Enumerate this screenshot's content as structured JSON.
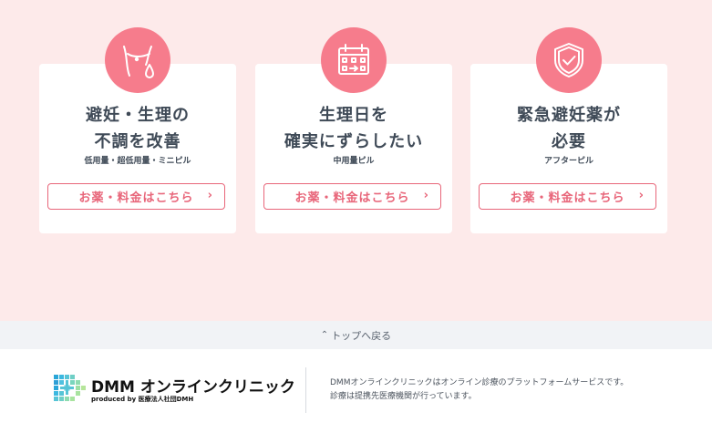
{
  "cards": [
    {
      "title1": "避妊・生理の",
      "title2": "不調を改善",
      "subtitle": "低用量・超低用量・ミニピル",
      "button": "お薬・料金はこちら",
      "icon": "body-droplet-icon"
    },
    {
      "title1": "生理日を",
      "title2": "確実にずらしたい",
      "subtitle": "中用量ピル",
      "button": "お薬・料金はこちら",
      "icon": "calendar-icon"
    },
    {
      "title1": "緊急避妊薬が",
      "title2": "必要",
      "subtitle": "アフターピル",
      "button": "お薬・料金はこちら",
      "icon": "shield-check-icon"
    }
  ],
  "back_to_top": "トップへ戻る",
  "footer": {
    "logo_text": "DMM オンラインクリニック",
    "produced_by": "produced by 医療法人社団DMH",
    "desc_line1": "DMMオンラインクリニックはオンライン診療のプラットフォームサービスです。",
    "desc_line2": "診療は提携先医療機関が行っています。"
  },
  "colors": {
    "accent": "#f67c8c",
    "button_border": "#e8667a",
    "background": "#fdeaea",
    "text": "#3f4a57"
  }
}
